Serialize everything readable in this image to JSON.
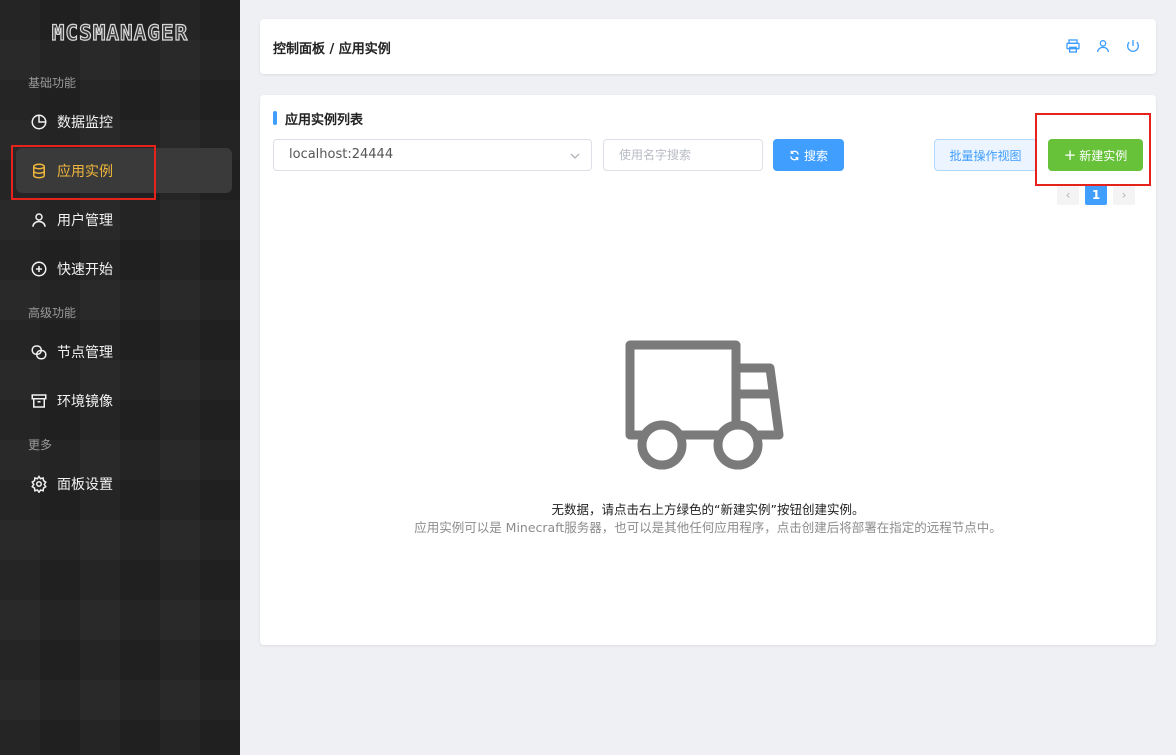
{
  "sidebar": {
    "logo": "MCSMANAGER",
    "groups": [
      "基础功能",
      "高级功能",
      "更多"
    ],
    "items": [
      {
        "label": "数据监控",
        "icon": "pie-chart-icon"
      },
      {
        "label": "应用实例",
        "icon": "database-icon"
      },
      {
        "label": "用户管理",
        "icon": "user-icon"
      },
      {
        "label": "快速开始",
        "icon": "plus-circle-icon"
      },
      {
        "label": "节点管理",
        "icon": "nodes-icon"
      },
      {
        "label": "环境镜像",
        "icon": "archive-box-icon"
      },
      {
        "label": "面板设置",
        "icon": "gear-icon"
      }
    ]
  },
  "header": {
    "breadcrumb": "控制面板 / 应用实例",
    "icons": [
      "printer-icon",
      "user-icon",
      "power-icon"
    ]
  },
  "main": {
    "title": "应用实例列表",
    "node_select": "localhost:24444",
    "search_placeholder": "使用名字搜索",
    "search_button": "搜索",
    "batch_button": "批量操作视图",
    "new_button": "新建实例",
    "pagination": {
      "current": "1",
      "prev": "‹",
      "next": "›"
    },
    "empty": {
      "icon": "truck-icon",
      "message": "无数据，请点击右上方绿色的“新建实例”按钮创建实例。",
      "hint": "应用实例可以是 Minecraft服务器，也可以是其他任何应用程序，点击创建后将部署在指定的远程节点中。"
    }
  },
  "colors": {
    "sidebar_bg": "#242424",
    "active_text": "#f0b73c",
    "primary": "#409eff",
    "success": "#67c23a",
    "highlight": "#e5231c"
  }
}
